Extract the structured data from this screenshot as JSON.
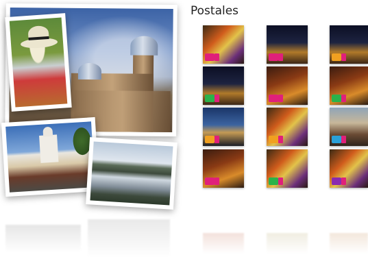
{
  "section": {
    "title": "Postales"
  },
  "photos": [
    {
      "name": "cathedral-photo",
      "subject": "cathedral"
    },
    {
      "name": "hat-photo",
      "subject": "panama-hat"
    },
    {
      "name": "plaza-photo",
      "subject": "plaza-market"
    },
    {
      "name": "lake-photo",
      "subject": "lake"
    }
  ],
  "thumbnails": {
    "rows": [
      [
        {
          "style": "t-fest",
          "logo": "#e0207a"
        },
        {
          "style": "t-night",
          "logo": "#e0207a"
        },
        {
          "style": "t-night",
          "logo": "#f0a020"
        }
      ],
      [
        {
          "style": "t-night",
          "logo": "#2bb24a"
        },
        {
          "style": "t-warm",
          "logo": "#e0207a"
        },
        {
          "style": "t-warm",
          "logo": "#2bb24a"
        }
      ],
      [
        {
          "style": "t-blue",
          "logo": "#f0a020"
        },
        {
          "style": "t-fest",
          "logo": "#f0a020"
        },
        {
          "style": "t-bridge",
          "logo": "#2aa0d8"
        }
      ],
      [
        {
          "style": "t-warm",
          "logo": "#e0207a"
        },
        {
          "style": "t-fest",
          "logo": "#2bb24a"
        },
        {
          "style": "t-fest",
          "logo": "#8a2ab0"
        }
      ]
    ]
  }
}
